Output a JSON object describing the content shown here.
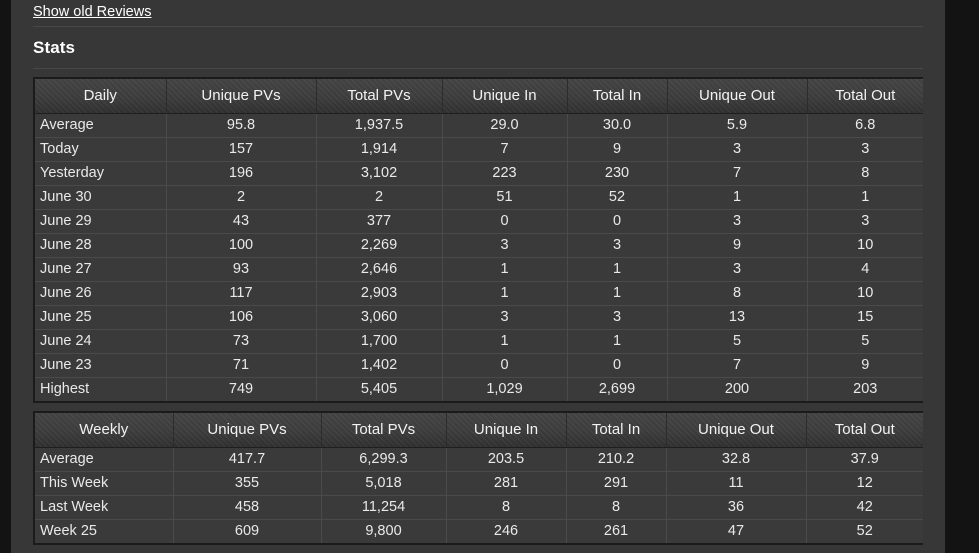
{
  "page": {
    "old_reviews_link": "Show old Reviews",
    "stats_heading": "Stats",
    "bg_color": "#373737",
    "outer_color": "#131313",
    "text_color": "#e9e9e9"
  },
  "daily_table": {
    "columns": [
      "Daily",
      "Unique PVs",
      "Total PVs",
      "Unique In",
      "Total In",
      "Unique Out",
      "Total Out"
    ],
    "rows": [
      [
        "Average",
        "95.8",
        "1,937.5",
        "29.0",
        "30.0",
        "5.9",
        "6.8"
      ],
      [
        "Today",
        "157",
        "1,914",
        "7",
        "9",
        "3",
        "3"
      ],
      [
        "Yesterday",
        "196",
        "3,102",
        "223",
        "230",
        "7",
        "8"
      ],
      [
        "June 30",
        "2",
        "2",
        "51",
        "52",
        "1",
        "1"
      ],
      [
        "June 29",
        "43",
        "377",
        "0",
        "0",
        "3",
        "3"
      ],
      [
        "June 28",
        "100",
        "2,269",
        "3",
        "3",
        "9",
        "10"
      ],
      [
        "June 27",
        "93",
        "2,646",
        "1",
        "1",
        "3",
        "4"
      ],
      [
        "June 26",
        "117",
        "2,903",
        "1",
        "1",
        "8",
        "10"
      ],
      [
        "June 25",
        "106",
        "3,060",
        "3",
        "3",
        "13",
        "15"
      ],
      [
        "June 24",
        "73",
        "1,700",
        "1",
        "1",
        "5",
        "5"
      ],
      [
        "June 23",
        "71",
        "1,402",
        "0",
        "0",
        "7",
        "9"
      ],
      [
        "Highest",
        "749",
        "5,405",
        "1,029",
        "2,699",
        "200",
        "203"
      ]
    ]
  },
  "weekly_table": {
    "columns": [
      "Weekly",
      "Unique PVs",
      "Total PVs",
      "Unique In",
      "Total In",
      "Unique Out",
      "Total Out"
    ],
    "rows": [
      [
        "Average",
        "417.7",
        "6,299.3",
        "203.5",
        "210.2",
        "32.8",
        "37.9"
      ],
      [
        "This Week",
        "355",
        "5,018",
        "281",
        "291",
        "11",
        "12"
      ],
      [
        "Last Week",
        "458",
        "11,254",
        "8",
        "8",
        "36",
        "42"
      ],
      [
        "Week 25",
        "609",
        "9,800",
        "246",
        "261",
        "47",
        "52"
      ]
    ]
  }
}
